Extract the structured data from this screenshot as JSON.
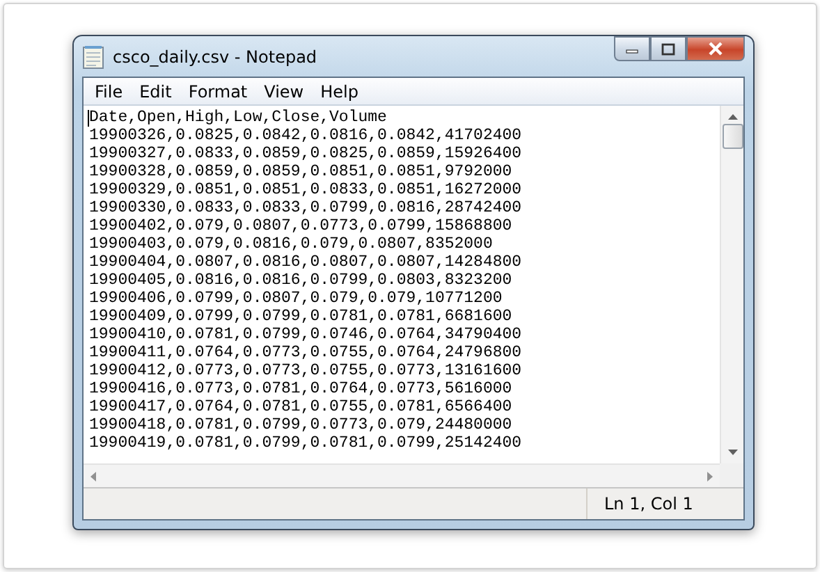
{
  "window": {
    "title": "csco_daily.csv - Notepad"
  },
  "menu": [
    "File",
    "Edit",
    "Format",
    "View",
    "Help"
  ],
  "lines": [
    "Date,Open,High,Low,Close,Volume",
    "19900326,0.0825,0.0842,0.0816,0.0842,41702400",
    "19900327,0.0833,0.0859,0.0825,0.0859,15926400",
    "19900328,0.0859,0.0859,0.0851,0.0851,9792000",
    "19900329,0.0851,0.0851,0.0833,0.0851,16272000",
    "19900330,0.0833,0.0833,0.0799,0.0816,28742400",
    "19900402,0.079,0.0807,0.0773,0.0799,15868800",
    "19900403,0.079,0.0816,0.079,0.0807,8352000",
    "19900404,0.0807,0.0816,0.0807,0.0807,14284800",
    "19900405,0.0816,0.0816,0.0799,0.0803,8323200",
    "19900406,0.0799,0.0807,0.079,0.079,10771200",
    "19900409,0.0799,0.0799,0.0781,0.0781,6681600",
    "19900410,0.0781,0.0799,0.0746,0.0764,34790400",
    "19900411,0.0764,0.0773,0.0755,0.0764,24796800",
    "19900412,0.0773,0.0773,0.0755,0.0773,13161600",
    "19900416,0.0773,0.0781,0.0764,0.0773,5616000",
    "19900417,0.0764,0.0781,0.0755,0.0781,6566400",
    "19900418,0.0781,0.0799,0.0773,0.079,24480000",
    "19900419,0.0781,0.0799,0.0781,0.0799,25142400"
  ],
  "status_bar": {
    "position": "Ln 1, Col 1"
  }
}
